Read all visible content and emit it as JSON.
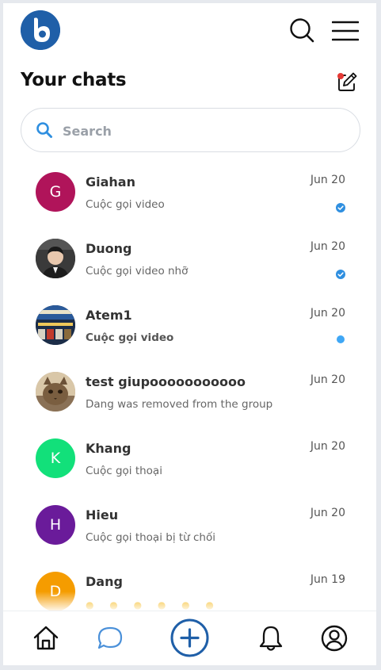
{
  "header": {
    "logo_icon": "app-logo",
    "search_icon": "search-icon",
    "menu_icon": "menu-icon"
  },
  "page_title": "Your chats",
  "compose_icon": "compose-icon",
  "search": {
    "placeholder": "Search",
    "value": ""
  },
  "chats": [
    {
      "name": "Giahan",
      "preview": "Cuộc gọi video",
      "date": "Jun 20",
      "avatar_letter": "G",
      "avatar_color": "#b0145a",
      "status": "read"
    },
    {
      "name": "Duong",
      "preview": "Cuộc gọi video nhỡ",
      "date": "Jun 20",
      "avatar_letter": "",
      "avatar_color": "#2b2b2b",
      "status": "read"
    },
    {
      "name": "Atem1",
      "preview": "Cuộc gọi video",
      "date": "Jun 20",
      "avatar_letter": "",
      "avatar_color": "#243b5a",
      "status": "unread"
    },
    {
      "name": "test giupooooooooooo",
      "preview": "Dang was removed from the group",
      "date": "Jun 20",
      "avatar_letter": "",
      "avatar_color": "#b59a78",
      "status": "none"
    },
    {
      "name": "Khang",
      "preview": "Cuộc gọi thoại",
      "date": "Jun 20",
      "avatar_letter": "K",
      "avatar_color": "#12e07a",
      "status": "none"
    },
    {
      "name": "Hieu",
      "preview": "Cuộc gọi thoại bị từ chối",
      "date": "Jun 20",
      "avatar_letter": "H",
      "avatar_color": "#6a1b9a",
      "status": "none"
    },
    {
      "name": "Dang",
      "preview": "",
      "date": "Jun 19",
      "avatar_letter": "D",
      "avatar_color": "#f59c00",
      "status": "none"
    }
  ],
  "bottom_nav": [
    {
      "icon": "home-icon"
    },
    {
      "icon": "chat-icon",
      "active": true
    },
    {
      "icon": "plus-circle-icon"
    },
    {
      "icon": "bell-icon"
    },
    {
      "icon": "profile-icon"
    }
  ],
  "colors": {
    "accent": "#1f5fa8",
    "active_nav": "#4a90d9",
    "unread_dot": "#3fa7f5",
    "compose_dot": "#e53935"
  }
}
